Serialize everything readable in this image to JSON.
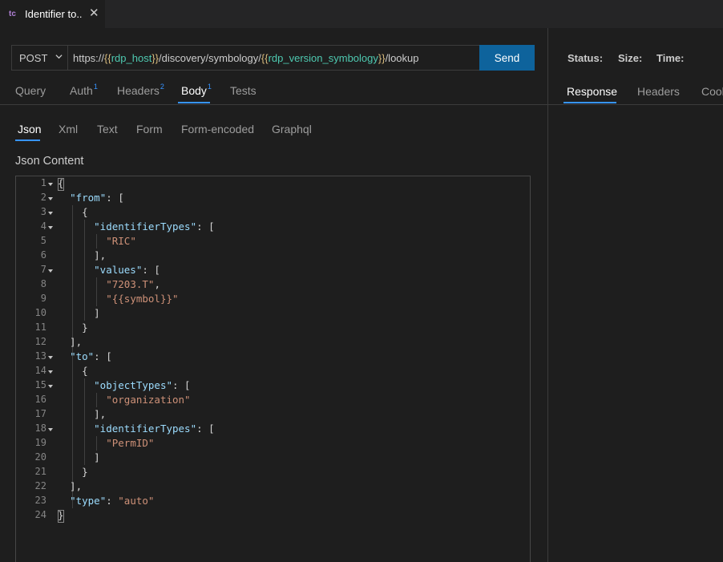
{
  "tab": {
    "icon": "tc",
    "title": "Identifier to..",
    "close": "✕"
  },
  "request": {
    "method": "POST",
    "url_parts": [
      {
        "t": "https://",
        "c": "plain"
      },
      {
        "t": "{{",
        "c": "brace"
      },
      {
        "t": "rdp_host",
        "c": "var"
      },
      {
        "t": "}}",
        "c": "brace"
      },
      {
        "t": "/discovery/symbology/",
        "c": "plain"
      },
      {
        "t": "{{",
        "c": "brace"
      },
      {
        "t": "rdp_version_symbology",
        "c": "var"
      },
      {
        "t": "}}",
        "c": "brace"
      },
      {
        "t": "/lookup",
        "c": "plain"
      }
    ],
    "send_label": "Send"
  },
  "request_tabs": {
    "query": "Query",
    "auth": "Auth",
    "auth_count": "1",
    "headers": "Headers",
    "headers_count": "2",
    "body": "Body",
    "body_count": "1",
    "tests": "Tests"
  },
  "body_tabs": {
    "json": "Json",
    "xml": "Xml",
    "text": "Text",
    "form": "Form",
    "form_encoded": "Form-encoded",
    "graphql": "Graphql"
  },
  "json_content_label": "Json Content",
  "editor_lines": [
    "{",
    "  \"from\": [",
    "    {",
    "      \"identifierTypes\": [",
    "        \"RIC\"",
    "      ],",
    "      \"values\": [",
    "        \"7203.T\",",
    "        \"{{symbol}}\"",
    "      ]",
    "    }",
    "  ],",
    "  \"to\": [",
    "    {",
    "      \"objectTypes\": [",
    "        \"organization\"",
    "      ],",
    "      \"identifierTypes\": [",
    "        \"PermID\"",
    "      ]",
    "    }",
    "  ],",
    "  \"type\": \"auto\"",
    "}"
  ],
  "fold_lines": [
    1,
    2,
    3,
    4,
    7,
    13,
    14,
    15,
    18
  ],
  "response": {
    "status_label": "Status:",
    "size_label": "Size:",
    "time_label": "Time:",
    "tabs": {
      "response": "Response",
      "headers": "Headers",
      "cookies": "Cookies"
    }
  },
  "colors": {
    "accent": "#3794ff",
    "send_bg": "#0e639c",
    "json_key": "#9cdcfe",
    "json_string": "#ce9178",
    "url_var": "#4ec9b0"
  }
}
